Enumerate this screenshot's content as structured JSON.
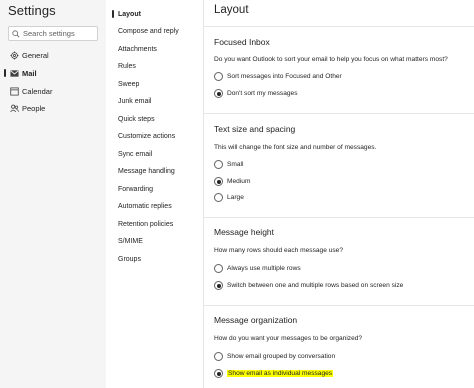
{
  "app": {
    "title": "Settings"
  },
  "search": {
    "placeholder": "Search settings"
  },
  "nav": [
    {
      "label": "General",
      "icon": "gear-icon",
      "active": false
    },
    {
      "label": "Mail",
      "icon": "mail-icon",
      "active": true
    },
    {
      "label": "Calendar",
      "icon": "calendar-icon",
      "active": false
    },
    {
      "label": "People",
      "icon": "people-icon",
      "active": false
    }
  ],
  "submenu": [
    "Layout",
    "Compose and reply",
    "Attachments",
    "Rules",
    "Sweep",
    "Junk email",
    "Quick steps",
    "Customize actions",
    "Sync email",
    "Message handling",
    "Forwarding",
    "Automatic replies",
    "Retention policies",
    "S/MIME",
    "Groups"
  ],
  "page": {
    "title": "Layout"
  },
  "sections": [
    {
      "title": "Focused Inbox",
      "question": "Do you want Outlook to sort your email to help you focus on what matters most?",
      "options": [
        {
          "label": "Sort messages into Focused and Other",
          "checked": false
        },
        {
          "label": "Don't sort my messages",
          "checked": true
        }
      ]
    },
    {
      "title": "Text size and spacing",
      "question": "This will change the font size and number of messages.",
      "options": [
        {
          "label": "Small",
          "checked": false
        },
        {
          "label": "Medium",
          "checked": true
        },
        {
          "label": "Large",
          "checked": false
        }
      ]
    },
    {
      "title": "Message height",
      "question": "How many rows should each message use?",
      "options": [
        {
          "label": "Always use multiple rows",
          "checked": false
        },
        {
          "label": "Switch between one and multiple rows based on screen size",
          "checked": true
        }
      ]
    },
    {
      "title": "Message organization",
      "question": "How do you want your messages to be organized?",
      "options": [
        {
          "label": "Show email grouped by conversation",
          "checked": false
        },
        {
          "label": "Show email as individual messages",
          "checked": true,
          "highlighted": true
        }
      ]
    }
  ],
  "colors": {
    "highlight": "#fcff00",
    "sidebar_bg": "#f5f5f5",
    "text": "#242424"
  }
}
